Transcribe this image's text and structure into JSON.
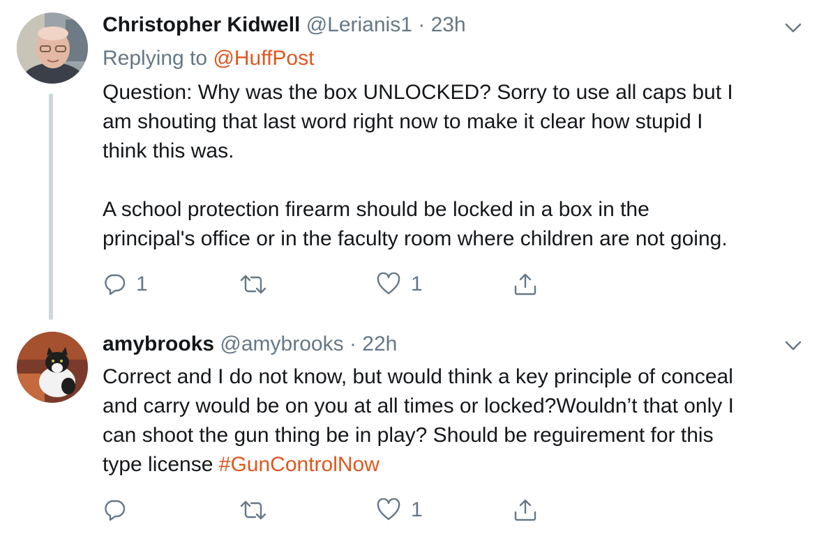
{
  "colors": {
    "accent": "#e0561e",
    "muted": "#657786",
    "text": "#14171a",
    "thread": "#ccd6dd"
  },
  "tweets": [
    {
      "name": "Christopher Kidwell",
      "handle": "@Lerianis1",
      "separator": "·",
      "time": "23h",
      "reply_prefix": "Replying to",
      "reply_handle": "@HuffPost",
      "text": "Question: Why was the box UNLOCKED? Sorry to use all caps but I\nam shouting that last word right now to make it clear how stupid I\nthink this was.\n\nA school protection firearm should be locked in a box in the\nprincipal's office or in the faculty room where children are not going.",
      "actions": {
        "reply_count": "1",
        "retweet_count": "",
        "like_count": "1"
      },
      "icons": {
        "reply": "reply-icon",
        "retweet": "retweet-icon",
        "like": "heart-icon",
        "share": "share-icon",
        "menu": "chevron-down-icon"
      }
    },
    {
      "name": "amybrooks",
      "handle": "@amybrooks",
      "separator": "·",
      "time": "22h",
      "text": "Correct and I do not know, but would think a key principle of conceal\nand carry would be on you at all times or locked?Wouldn’t that only I\ncan shoot the gun thing be in play? Should be reguirement for this\ntype license ",
      "hashtag": "#GunControlNow",
      "actions": {
        "reply_count": "",
        "retweet_count": "",
        "like_count": "1"
      },
      "icons": {
        "reply": "reply-icon",
        "retweet": "retweet-icon",
        "like": "heart-icon",
        "share": "share-icon",
        "menu": "chevron-down-icon"
      }
    }
  ]
}
